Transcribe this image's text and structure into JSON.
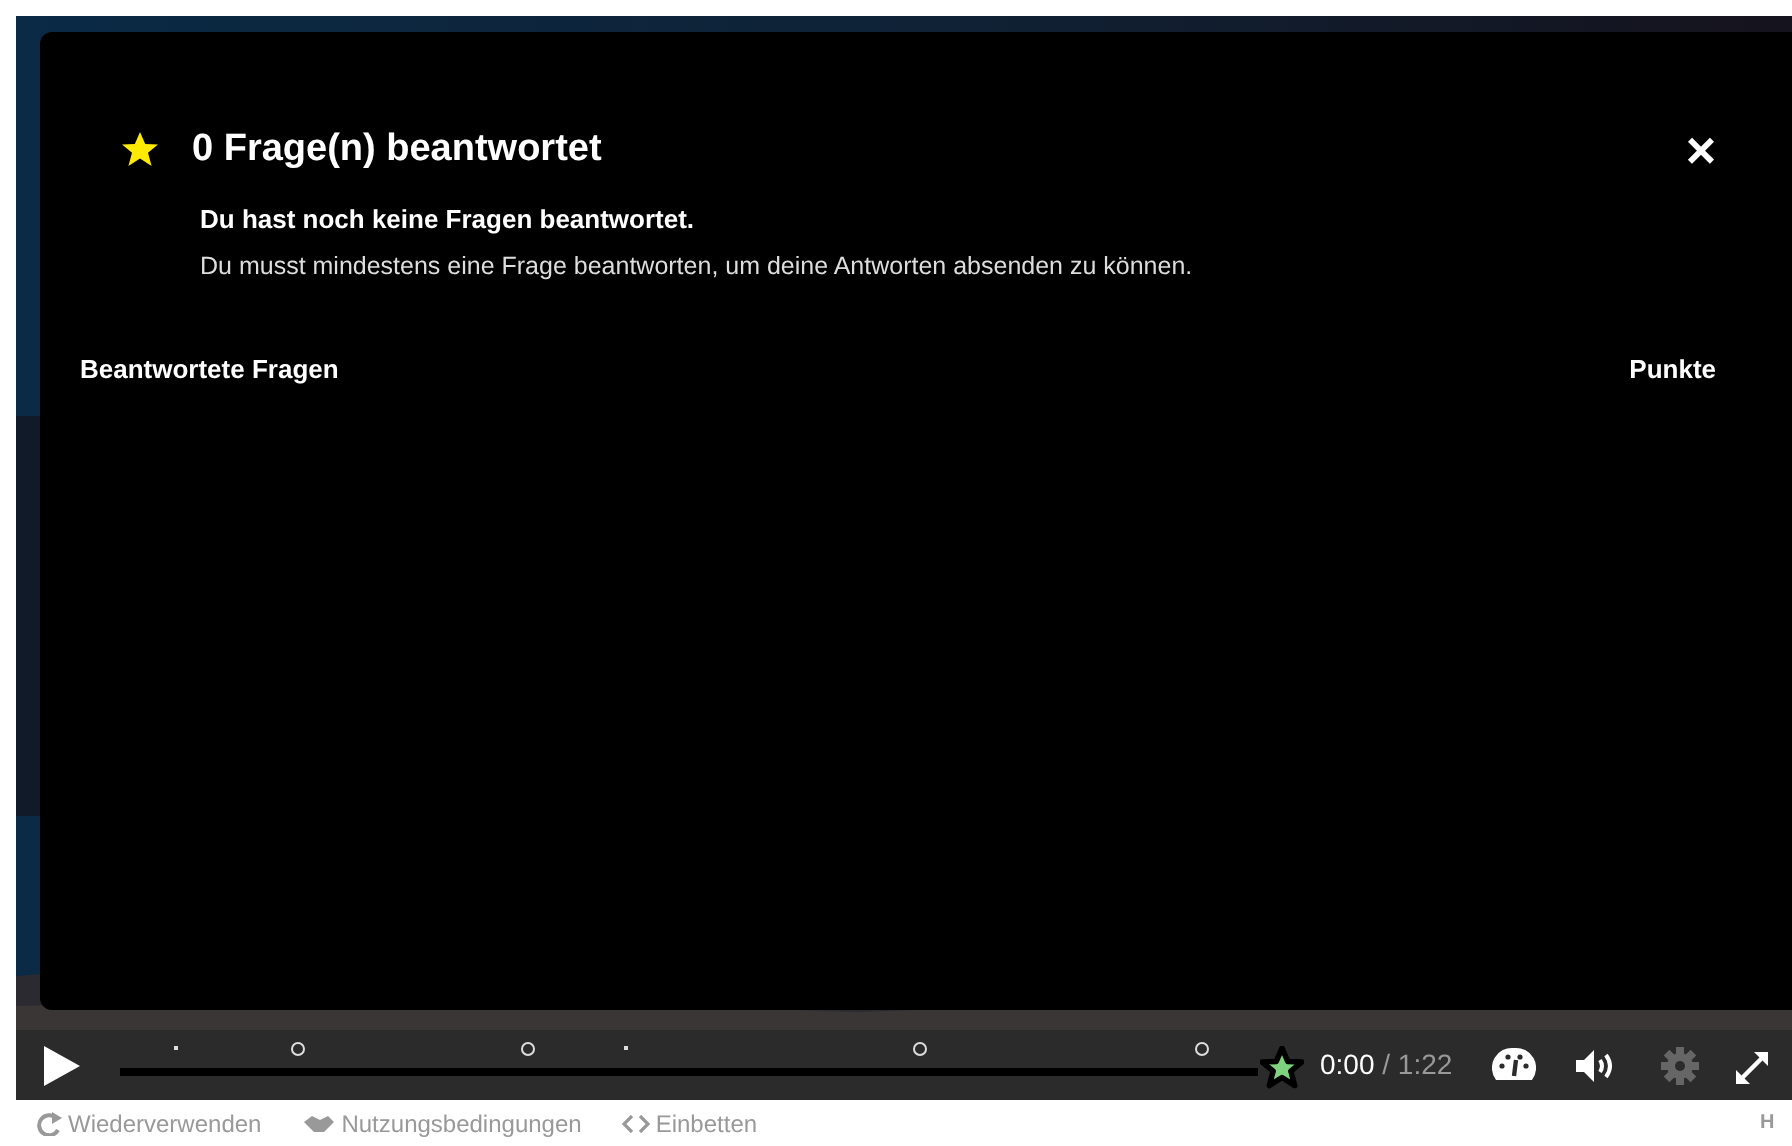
{
  "summary": {
    "title": "0 Frage(n) beantwortet",
    "close": "×",
    "heading": "Du hast noch keine Fragen beantwortet.",
    "message": "Du musst mindestens eine Frage beantworten, um deine Antworten absenden zu können.",
    "columns": [
      "Beantwortete Fragen",
      "Punkte"
    ]
  },
  "controls": {
    "progress": {
      "level": 0
    },
    "markers": [
      {
        "kind": "dot",
        "level": 0.05
      },
      {
        "kind": "circle",
        "level": 0.157
      },
      {
        "kind": "circle",
        "level": 0.359
      },
      {
        "kind": "dot",
        "level": 0.445
      },
      {
        "kind": "circle",
        "level": 0.703
      },
      {
        "kind": "circle",
        "level": 0.95
      }
    ],
    "current_time": "0:00",
    "total_time": "/ 1:22",
    "settings_disabled": true
  },
  "footer": {
    "links": [
      {
        "kind": "reuse",
        "label": "Wiederverwenden"
      },
      {
        "kind": "rights",
        "label": "Nutzungsbedingungen"
      },
      {
        "kind": "embed",
        "label": "Einbetten"
      }
    ],
    "logo": "H"
  }
}
